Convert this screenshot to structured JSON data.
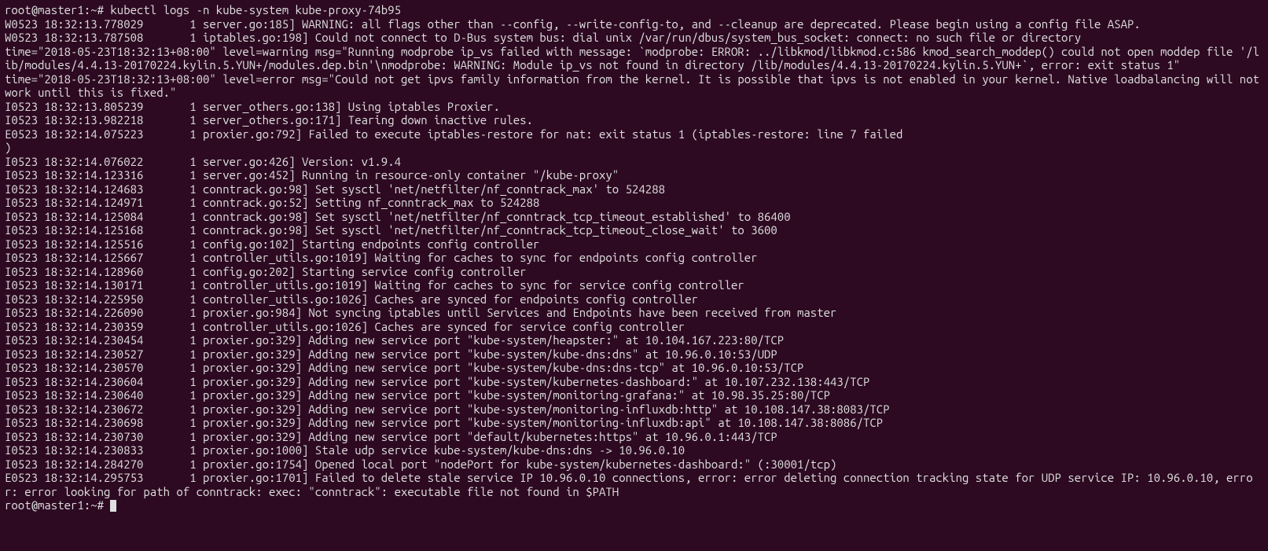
{
  "terminal": {
    "prompt1": "root@master1:~# ",
    "command": "kubectl logs -n kube-system kube-proxy-74b95",
    "lines": [
      "W0523 18:32:13.778029       1 server.go:185] WARNING: all flags other than --config, --write-config-to, and --cleanup are deprecated. Please begin using a config file ASAP.",
      "W0523 18:32:13.787508       1 iptables.go:198] Could not connect to D-Bus system bus: dial unix /var/run/dbus/system_bus_socket: connect: no such file or directory",
      "time=\"2018-05-23T18:32:13+08:00\" level=warning msg=\"Running modprobe ip_vs failed with message: `modprobe: ERROR: ../libkmod/libkmod.c:586 kmod_search_moddep() could not open moddep file '/lib/modules/4.4.13-20170224.kylin.5.YUN+/modules.dep.bin'\\nmodprobe: WARNING: Module ip_vs not found in directory /lib/modules/4.4.13-20170224.kylin.5.YUN+`, error: exit status 1\"",
      "time=\"2018-05-23T18:32:13+08:00\" level=error msg=\"Could not get ipvs family information from the kernel. It is possible that ipvs is not enabled in your kernel. Native loadbalancing will not work until this is fixed.\"",
      "I0523 18:32:13.805239       1 server_others.go:138] Using iptables Proxier.",
      "I0523 18:32:13.982218       1 server_others.go:171] Tearing down inactive rules.",
      "E0523 18:32:14.075223       1 proxier.go:792] Failed to execute iptables-restore for nat: exit status 1 (iptables-restore: line 7 failed",
      ")",
      "I0523 18:32:14.076022       1 server.go:426] Version: v1.9.4",
      "I0523 18:32:14.123316       1 server.go:452] Running in resource-only container \"/kube-proxy\"",
      "I0523 18:32:14.124683       1 conntrack.go:98] Set sysctl 'net/netfilter/nf_conntrack_max' to 524288",
      "I0523 18:32:14.124971       1 conntrack.go:52] Setting nf_conntrack_max to 524288",
      "I0523 18:32:14.125084       1 conntrack.go:98] Set sysctl 'net/netfilter/nf_conntrack_tcp_timeout_established' to 86400",
      "I0523 18:32:14.125168       1 conntrack.go:98] Set sysctl 'net/netfilter/nf_conntrack_tcp_timeout_close_wait' to 3600",
      "I0523 18:32:14.125516       1 config.go:102] Starting endpoints config controller",
      "I0523 18:32:14.125667       1 controller_utils.go:1019] Waiting for caches to sync for endpoints config controller",
      "I0523 18:32:14.128960       1 config.go:202] Starting service config controller",
      "I0523 18:32:14.130171       1 controller_utils.go:1019] Waiting for caches to sync for service config controller",
      "I0523 18:32:14.225950       1 controller_utils.go:1026] Caches are synced for endpoints config controller",
      "I0523 18:32:14.226090       1 proxier.go:984] Not syncing iptables until Services and Endpoints have been received from master",
      "I0523 18:32:14.230359       1 controller_utils.go:1026] Caches are synced for service config controller",
      "I0523 18:32:14.230454       1 proxier.go:329] Adding new service port \"kube-system/heapster:\" at 10.104.167.223:80/TCP",
      "I0523 18:32:14.230527       1 proxier.go:329] Adding new service port \"kube-system/kube-dns:dns\" at 10.96.0.10:53/UDP",
      "I0523 18:32:14.230570       1 proxier.go:329] Adding new service port \"kube-system/kube-dns:dns-tcp\" at 10.96.0.10:53/TCP",
      "I0523 18:32:14.230604       1 proxier.go:329] Adding new service port \"kube-system/kubernetes-dashboard:\" at 10.107.232.138:443/TCP",
      "I0523 18:32:14.230640       1 proxier.go:329] Adding new service port \"kube-system/monitoring-grafana:\" at 10.98.35.25:80/TCP",
      "I0523 18:32:14.230672       1 proxier.go:329] Adding new service port \"kube-system/monitoring-influxdb:http\" at 10.108.147.38:8083/TCP",
      "I0523 18:32:14.230698       1 proxier.go:329] Adding new service port \"kube-system/monitoring-influxdb:api\" at 10.108.147.38:8086/TCP",
      "I0523 18:32:14.230730       1 proxier.go:329] Adding new service port \"default/kubernetes:https\" at 10.96.0.1:443/TCP",
      "I0523 18:32:14.230833       1 proxier.go:1000] Stale udp service kube-system/kube-dns:dns -> 10.96.0.10",
      "I0523 18:32:14.284270       1 proxier.go:1754] Opened local port \"nodePort for kube-system/kubernetes-dashboard:\" (:30001/tcp)",
      "E0523 18:32:14.295753       1 proxier.go:1701] Failed to delete stale service IP 10.96.0.10 connections, error: error deleting connection tracking state for UDP service IP: 10.96.0.10, error: error looking for path of conntrack: exec: \"conntrack\": executable file not found in $PATH"
    ],
    "prompt2": "root@master1:~# "
  }
}
